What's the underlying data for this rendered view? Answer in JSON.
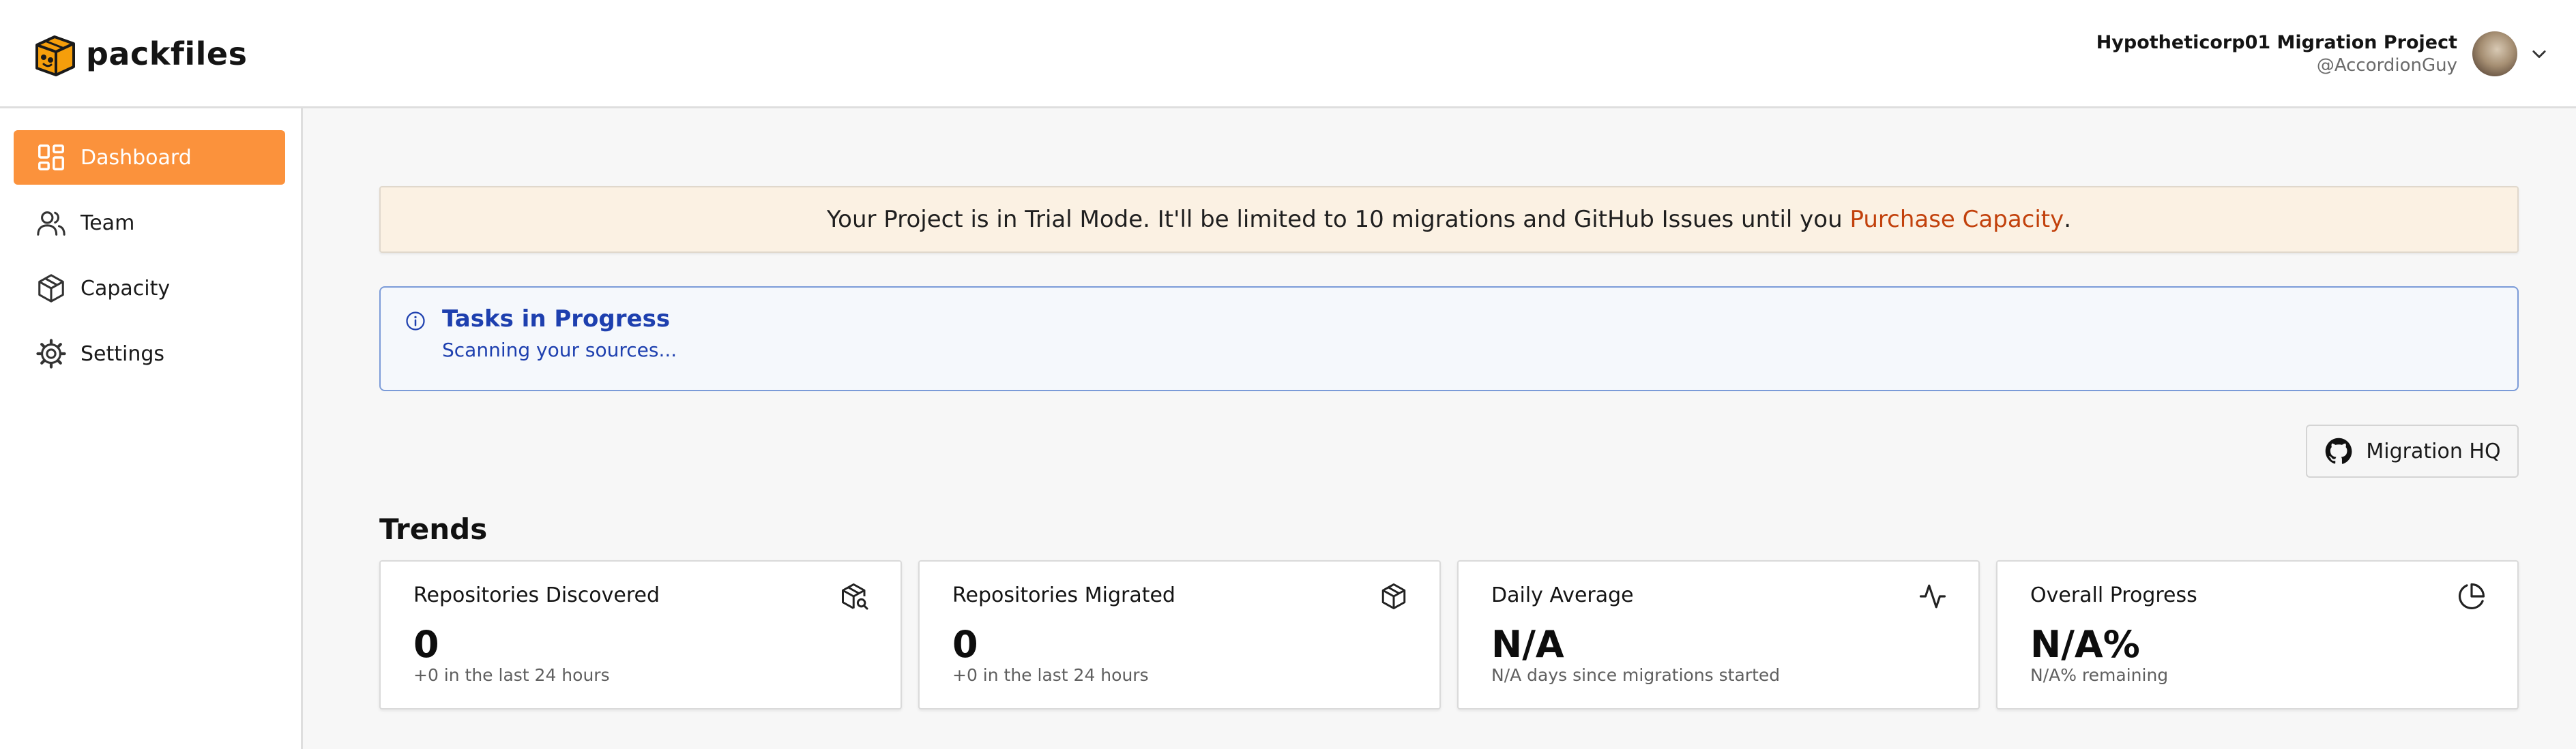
{
  "header": {
    "brand": "packfiles",
    "project_name": "Hypotheticorp01 Migration Project",
    "user_handle": "@AccordionGuy"
  },
  "sidebar": {
    "items": [
      {
        "label": "Dashboard",
        "icon": "dashboard-icon",
        "active": true
      },
      {
        "label": "Team",
        "icon": "team-icon",
        "active": false
      },
      {
        "label": "Capacity",
        "icon": "cube-icon",
        "active": false
      },
      {
        "label": "Settings",
        "icon": "gear-icon",
        "active": false
      }
    ]
  },
  "banner": {
    "text": "Your Project is in Trial Mode. It'll be limited to 10 migrations and GitHub Issues until you ",
    "link": "Purchase Capacity",
    "suffix": "."
  },
  "tasks": {
    "title": "Tasks in Progress",
    "subtitle": "Scanning your sources..."
  },
  "migration_hq": {
    "label": "Migration HQ",
    "icon": "github-icon"
  },
  "trends": {
    "title": "Trends",
    "cards": [
      {
        "title": "Repositories Discovered",
        "value": "0",
        "sub": "+0 in the last 24 hours",
        "icon": "package-search-icon"
      },
      {
        "title": "Repositories Migrated",
        "value": "0",
        "sub": "+0 in the last 24 hours",
        "icon": "package-icon"
      },
      {
        "title": "Daily Average",
        "value": "N/A",
        "sub": "N/A days since migrations started",
        "icon": "activity-icon"
      },
      {
        "title": "Overall Progress",
        "value": "N/A%",
        "sub": "N/A% remaining",
        "icon": "pie-chart-icon"
      }
    ]
  },
  "colors": {
    "accent": "#fb923c",
    "banner_bg": "#fbf1e3",
    "banner_link": "#c2410c",
    "info_text": "#1e40af",
    "info_border": "#7b9bd8"
  }
}
